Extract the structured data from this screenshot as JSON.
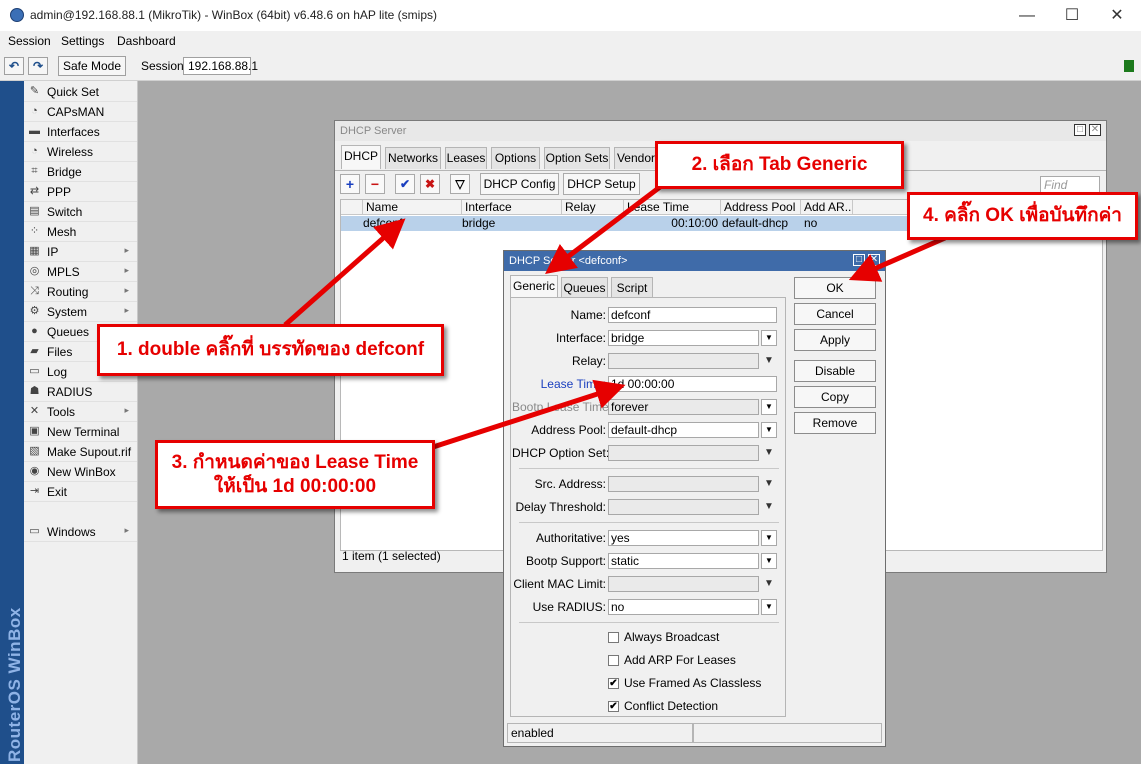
{
  "titlebar": {
    "title": "admin@192.168.88.1 (MikroTik) - WinBox (64bit) v6.48.6 on hAP lite (smips)",
    "minimize": "—",
    "maximize": "☐",
    "close": "✕"
  },
  "menubar": {
    "items": [
      "Session",
      "Settings",
      "Dashboard"
    ]
  },
  "toolbar": {
    "undo": "↶",
    "redo": "↷",
    "safe_mode": "Safe Mode",
    "session_label": "Session:",
    "session_value": "192.168.88.1"
  },
  "brand": "RouterOS WinBox",
  "sidebar": {
    "items": [
      {
        "label": "Quick Set",
        "icon": "✎",
        "arrow": ""
      },
      {
        "label": "CAPsMAN",
        "icon": "◔",
        "arrow": ""
      },
      {
        "label": "Interfaces",
        "icon": "▬",
        "arrow": ""
      },
      {
        "label": "Wireless",
        "icon": "◔",
        "arrow": ""
      },
      {
        "label": "Bridge",
        "icon": "⌗",
        "arrow": ""
      },
      {
        "label": "PPP",
        "icon": "⇄",
        "arrow": ""
      },
      {
        "label": "Switch",
        "icon": "▤",
        "arrow": ""
      },
      {
        "label": "Mesh",
        "icon": "⁘",
        "arrow": ""
      },
      {
        "label": "IP",
        "icon": "▦",
        "arrow": "▸"
      },
      {
        "label": "MPLS",
        "icon": "◎",
        "arrow": "▸"
      },
      {
        "label": "Routing",
        "icon": "⤨",
        "arrow": "▸"
      },
      {
        "label": "System",
        "icon": "⚙",
        "arrow": "▸"
      },
      {
        "label": "Queues",
        "icon": "●",
        "arrow": ""
      },
      {
        "label": "Files",
        "icon": "▰",
        "arrow": ""
      },
      {
        "label": "Log",
        "icon": "▭",
        "arrow": ""
      },
      {
        "label": "RADIUS",
        "icon": "☗",
        "arrow": ""
      },
      {
        "label": "Tools",
        "icon": "✕",
        "arrow": "▸"
      },
      {
        "label": "New Terminal",
        "icon": "▣",
        "arrow": ""
      },
      {
        "label": "Make Supout.rif",
        "icon": "▧",
        "arrow": ""
      },
      {
        "label": "New WinBox",
        "icon": "◉",
        "arrow": ""
      },
      {
        "label": "Exit",
        "icon": "⇥",
        "arrow": ""
      },
      {
        "label": "",
        "icon": "",
        "arrow": ""
      },
      {
        "label": "Windows",
        "icon": "▭",
        "arrow": "▸"
      }
    ]
  },
  "dhcp_window": {
    "title": "DHCP Server",
    "tabs": [
      "DHCP",
      "Networks",
      "Leases",
      "Options",
      "Option Sets",
      "Vendor"
    ],
    "buttons": {
      "add": "+",
      "remove": "−",
      "enable": "✔",
      "disable": "✖",
      "filter": "▽",
      "dhcp_config": "DHCP Config",
      "dhcp_setup": "DHCP Setup"
    },
    "find_placeholder": "Find",
    "columns": [
      "Name",
      "Interface",
      "Relay",
      "Lease Time",
      "Address Pool",
      "Add AR..."
    ],
    "rows": [
      {
        "name": "defconf",
        "interface": "bridge",
        "relay": "",
        "lease_time": "00:10:00",
        "address_pool": "default-dhcp",
        "add_arp": "no"
      }
    ],
    "status": "1 item (1 selected)"
  },
  "dialog": {
    "title": "DHCP Server <defconf>",
    "tabs": [
      "Generic",
      "Queues",
      "Script"
    ],
    "fields": {
      "name": {
        "label": "Name:",
        "value": "defconf"
      },
      "interface": {
        "label": "Interface:",
        "value": "bridge"
      },
      "relay": {
        "label": "Relay:",
        "value": ""
      },
      "lease_time": {
        "label": "Lease Time:",
        "value": "1d 00:00:00"
      },
      "bootp_lease_time": {
        "label": "Bootp Lease Time:",
        "value": "forever"
      },
      "address_pool": {
        "label": "Address Pool:",
        "value": "default-dhcp"
      },
      "dhcp_option_set": {
        "label": "DHCP Option Set:",
        "value": ""
      },
      "src_address": {
        "label": "Src. Address:",
        "value": ""
      },
      "delay_threshold": {
        "label": "Delay Threshold:",
        "value": ""
      },
      "authoritative": {
        "label": "Authoritative:",
        "value": "yes"
      },
      "bootp_support": {
        "label": "Bootp Support:",
        "value": "static"
      },
      "client_mac_limit": {
        "label": "Client MAC Limit:",
        "value": ""
      },
      "use_radius": {
        "label": "Use RADIUS:",
        "value": "no"
      }
    },
    "checkboxes": [
      {
        "label": "Always Broadcast",
        "checked": ""
      },
      {
        "label": "Add ARP For Leases",
        "checked": ""
      },
      {
        "label": "Use Framed As Classless",
        "checked": "✔"
      },
      {
        "label": "Conflict Detection",
        "checked": "✔"
      }
    ],
    "buttons": [
      "OK",
      "Cancel",
      "Apply",
      "Disable",
      "Copy",
      "Remove"
    ],
    "status": "enabled"
  },
  "annotations": {
    "step1": "1. double คลิ๊กที่ บรรทัดของ defconf",
    "step2": "2. เลือก Tab Generic",
    "step3_line1": "3. กำหนดค่าของ Lease Time",
    "step3_line2": "ให้เป็น 1d 00:00:00",
    "step4": "4. คลิ๊ก OK เพื่อบันทึกค่า"
  },
  "colors": {
    "annotation_red": "#e60000",
    "dialog_title": "#3f6ba9",
    "selection": "#b9d1ea",
    "brand_bar": "#1f4f8b",
    "workspace": "#a9a9a9"
  }
}
